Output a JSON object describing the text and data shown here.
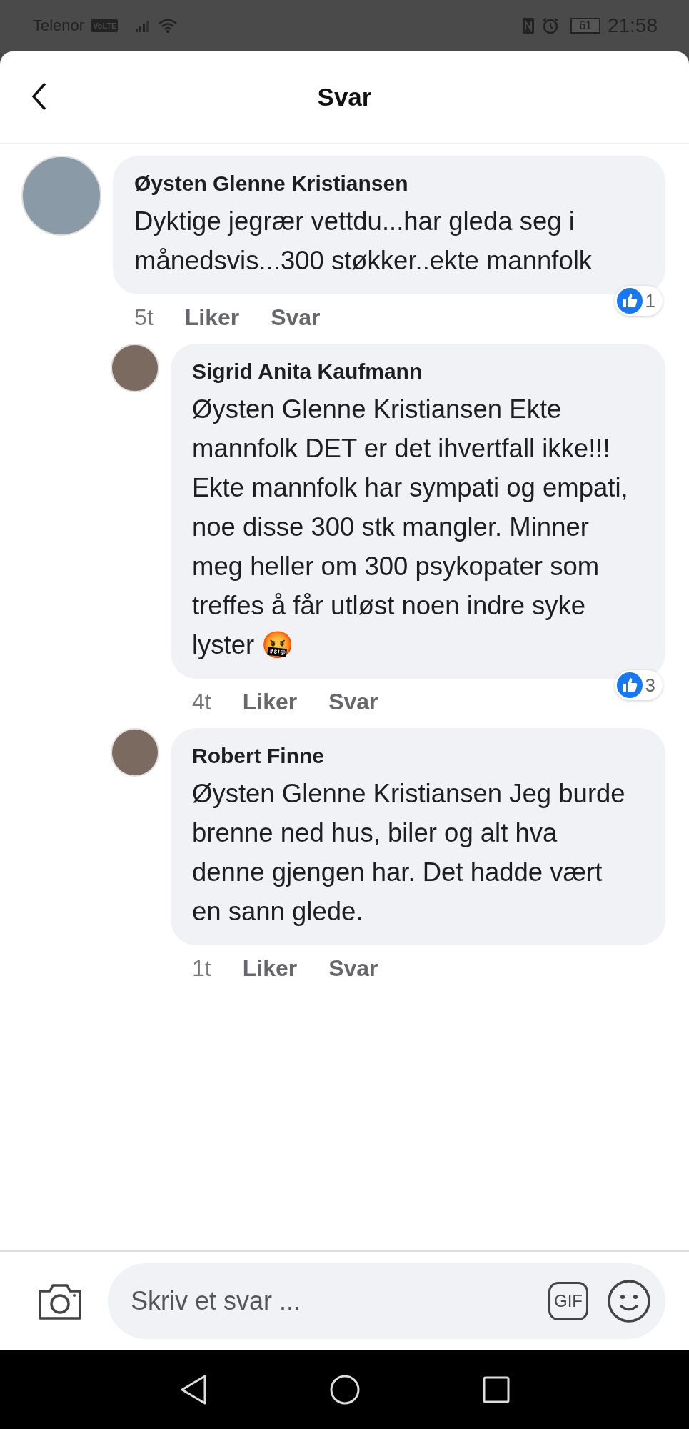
{
  "status_bar": {
    "carrier": "Telenor",
    "network_badge": "VoLTE",
    "battery": "61",
    "time": "21:58"
  },
  "header": {
    "title": "Svar"
  },
  "comment": {
    "author": "Øysten Glenne Kristiansen",
    "text": "Dyktige jegrær vettdu...har gleda seg i månedsvis...300 støkker..ekte mannfolk",
    "time": "5t",
    "like_label": "Liker",
    "reply_label": "Svar",
    "reaction_count": "1",
    "replies": [
      {
        "author": "Sigrid Anita Kaufmann",
        "text": "Øysten Glenne Kristiansen Ekte mannfolk DET er det ihvertfall ikke!!! Ekte mannfolk har sympati og empati, noe disse 300 stk mangler. Minner meg heller om 300 psykopater som treffes å får utløst noen indre syke lyster 🤬",
        "time": "4t",
        "like_label": "Liker",
        "reply_label": "Svar",
        "reaction_count": "3"
      },
      {
        "author": "Robert Finne",
        "text": "Øysten Glenne Kristiansen Jeg burde brenne ned hus, biler og alt hva denne gjengen har. Det hadde vært en sann glede.",
        "time": "1t",
        "like_label": "Liker",
        "reply_label": "Svar"
      }
    ]
  },
  "composer": {
    "placeholder": "Skriv et svar ...",
    "gif_label": "GIF"
  }
}
